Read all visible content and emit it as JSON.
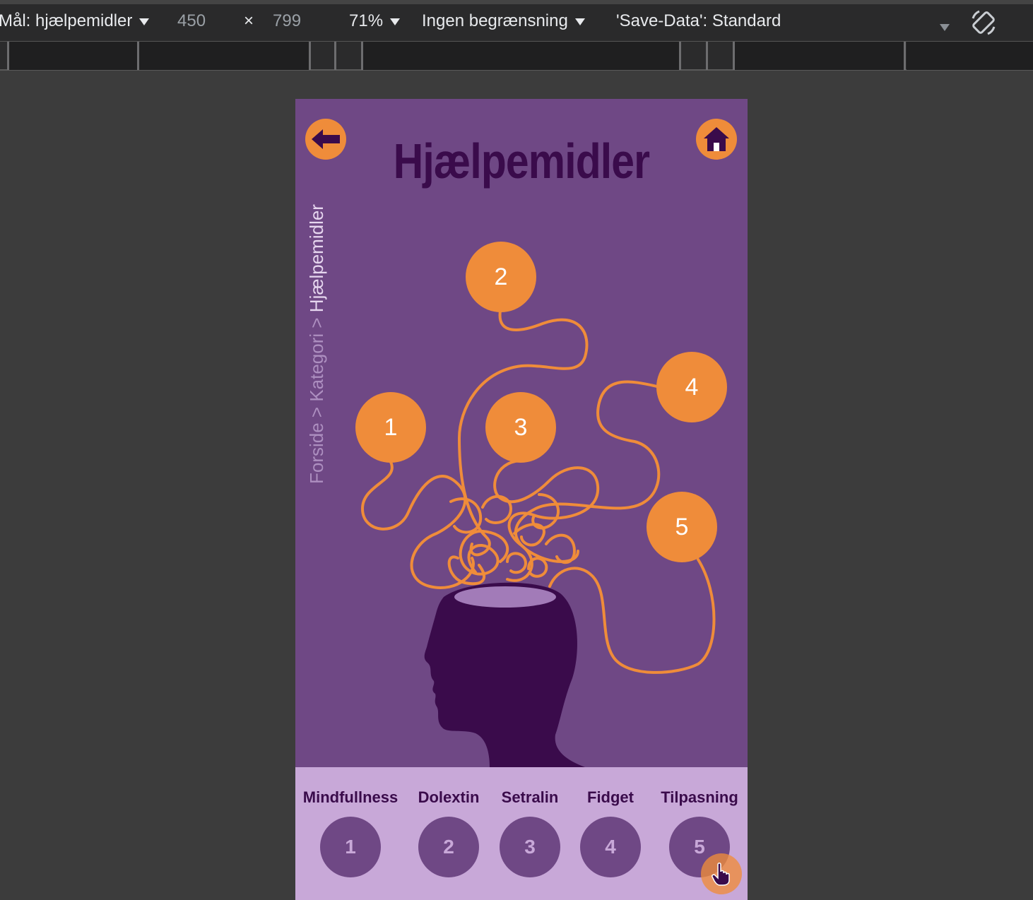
{
  "devtools": {
    "target_label": "Mål: hjælpemidler",
    "width": "450",
    "times": "×",
    "height": "799",
    "zoom": "71%",
    "throttling": "Ingen begrænsning",
    "save_data": "'Save-Data': Standard",
    "rotate_icon": "rotate-icon"
  },
  "page": {
    "title": "Hjælpemidler",
    "breadcrumb": {
      "path": "Forside > Kategori > ",
      "current": "Hjælpemidler"
    },
    "back_icon": "arrow-left-icon",
    "home_icon": "home-icon",
    "bubbles": [
      "1",
      "2",
      "3",
      "4",
      "5"
    ],
    "nav": [
      {
        "label": "Mindfullness",
        "number": "1"
      },
      {
        "label": "Dolextin",
        "number": "2"
      },
      {
        "label": "Setralin",
        "number": "3"
      },
      {
        "label": "Fidget",
        "number": "4"
      },
      {
        "label": "Tilpasning",
        "number": "5"
      }
    ]
  },
  "colors": {
    "page_bg": "#6f4885",
    "accent_orange": "#ef8c3a",
    "dark_purple": "#3a0b4b",
    "light_purple": "#c8a8d8"
  }
}
